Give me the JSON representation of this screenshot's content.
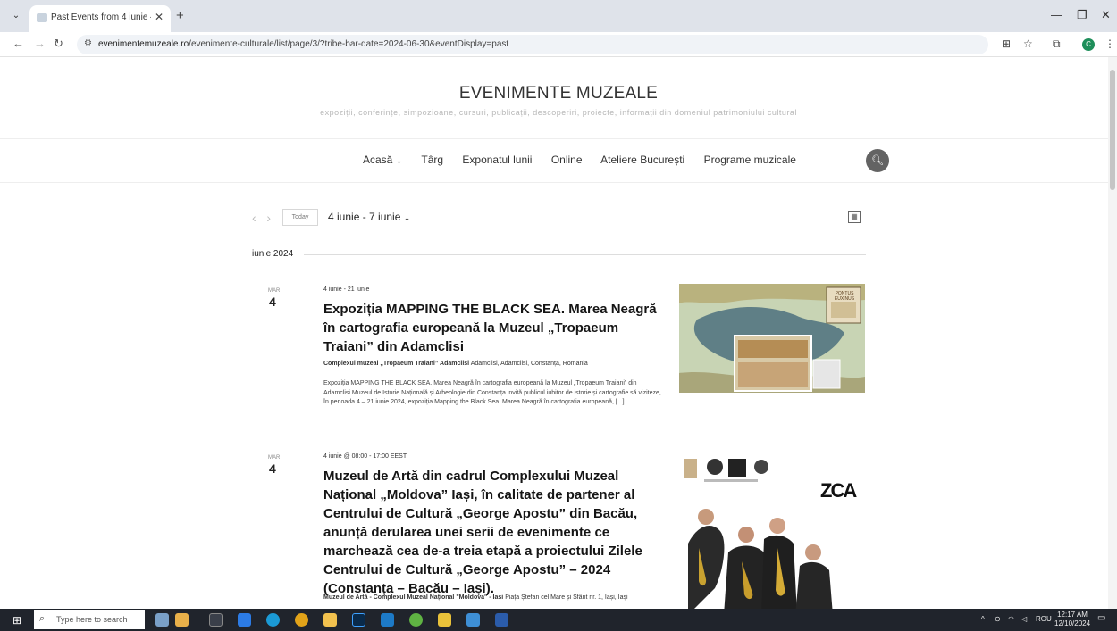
{
  "browser": {
    "tab_title": "Past Events from 4 iunie – 7 iun",
    "url_domain": "evenimentemuzeale.ro",
    "url_path": "/evenimente-culturale/list/page/3/?tribe-bar-date=2024-06-30&eventDisplay=past",
    "new_tab": "+",
    "close_tab": "✕",
    "minimize": "—",
    "restore": "❐",
    "close_window": "✕",
    "profile_initial": "C"
  },
  "site": {
    "title": "EVENIMENTE MUZEALE",
    "tagline": "expoziții, conferințe, simpozioane, cursuri, publicații, descoperiri, proiecte, informații din domeniul patrimoniului cultural"
  },
  "nav": {
    "items": [
      "Acasă",
      "Târg",
      "Exponatul lunii",
      "Online",
      "Ateliere București",
      "Programe muzicale"
    ],
    "acasa_caret": "⌄"
  },
  "toolbar": {
    "today_label": "Today",
    "range_label": "4 iunie - 7 iunie",
    "range_caret": "⌄"
  },
  "month_label": "iunie 2024",
  "events": [
    {
      "dow": "MAR",
      "day": "4",
      "datetime": "4 iunie - 21 iunie",
      "title": "Expoziția MAPPING THE BLACK SEA. Marea Neagră în cartografia europeană la Muzeul „Tropaeum Traiani” din Adamclisi",
      "venue_name": "Complexul muzeal „Tropaeum Traiani” Adamclisi",
      "venue_addr": "Adamclisi, Adamclisi, Constanța, Romania",
      "description": "Expoziția MAPPING THE BLACK SEA. Marea Neagră în cartografia europeană la Muzeul „Tropaeum Traiani” din Adamclisi Muzeul de Istorie Națională și Arheologie din Constanța invită publicul iubitor de istorie și cartografie să viziteze, în perioada 4 – 21 iunie 2024, expoziția Mapping the Black Sea. Marea Neagră în cartografia europeană, [...]",
      "image_badge": "PONTUS EUXINUS"
    },
    {
      "dow": "MAR",
      "day": "4",
      "datetime": "4 iunie @ 08:00 - 17:00 EEST",
      "title": "Muzeul de Artă din cadrul Complexului Muzeal Național „Moldova” Iași, în calitate de partener al Centrului de Cultură „George Apostu” din Bacău, anunță derularea unei serii de evenimente ce marchează cea de-a treia etapă a proiectului Zilele Centrului de Cultură „George Apostu” – 2024 (Constanța – Bacău – Iași).",
      "venue_name": "Muzeul de Artă - Complexul Muzeal Național \"Moldova\" - Iași",
      "venue_addr": "Piața Ștefan cel Mare și Sfânt nr. 1, Iași, Iași",
      "image_badge": "ZCA"
    }
  ],
  "taskbar": {
    "search_placeholder": "Type here to search",
    "language": "ROU",
    "time": "12:17 AM",
    "date": "12/10/2024"
  },
  "colors": {
    "tabbar_bg": "#dfe3ea",
    "taskbar_bg": "#20242c",
    "search_button": "#636363",
    "profile": "#1e8e5a"
  }
}
